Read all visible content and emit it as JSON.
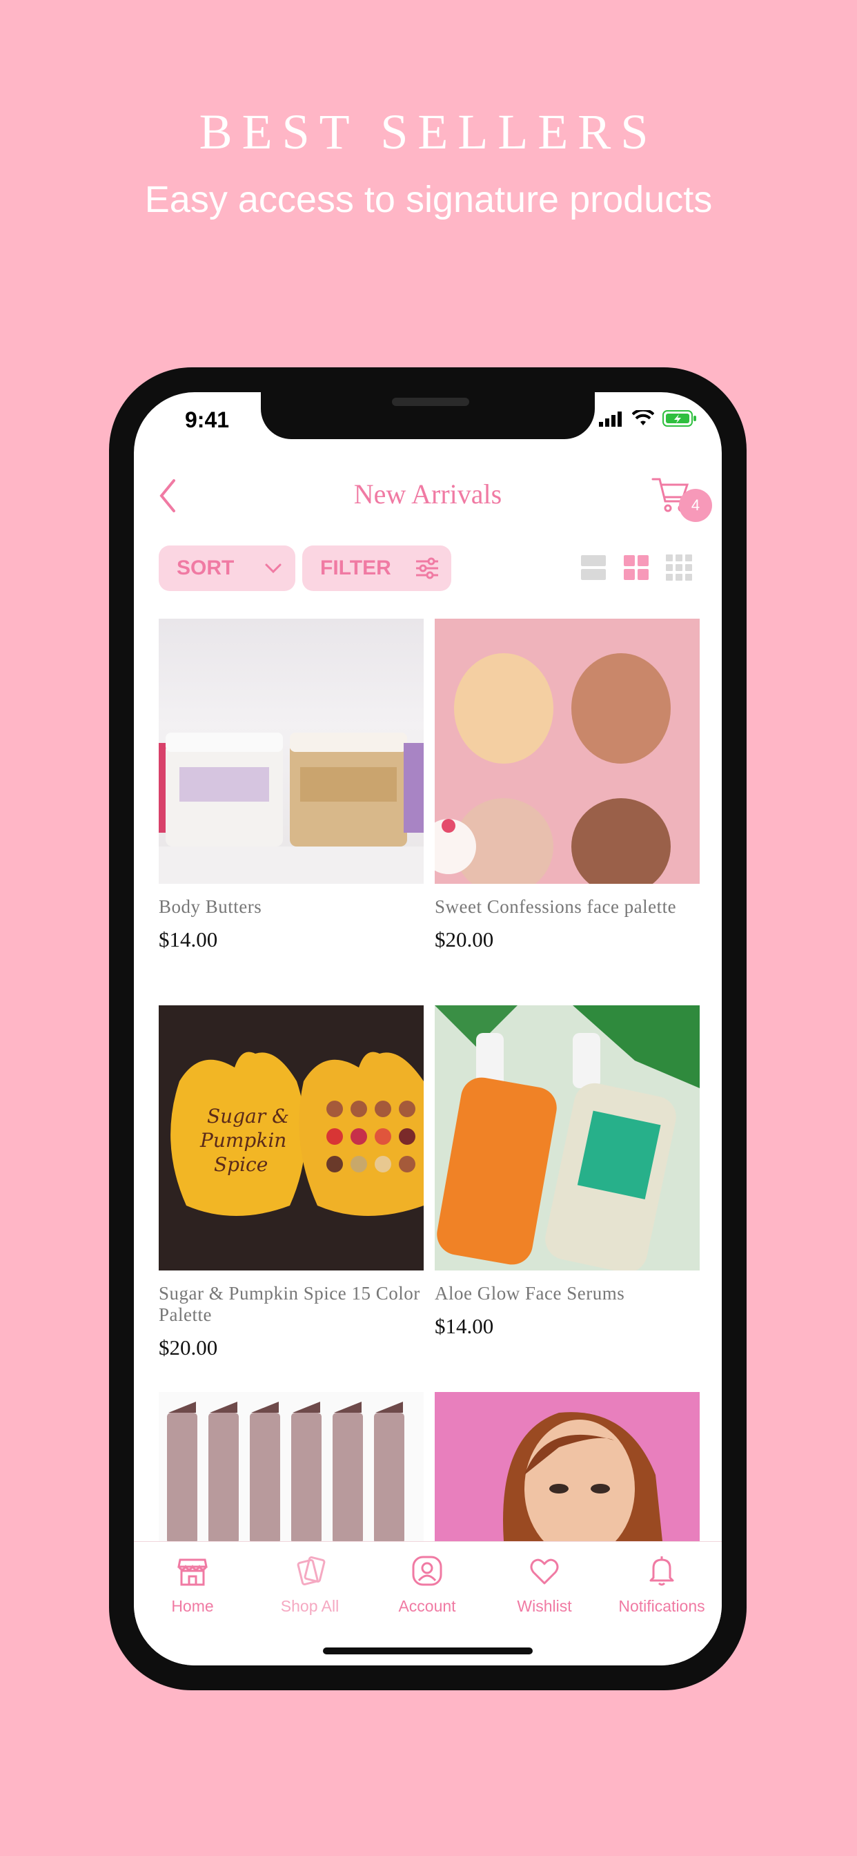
{
  "hero": {
    "title": "BEST SELLERS",
    "subtitle": "Easy access to signature products"
  },
  "status_bar": {
    "time": "9:41"
  },
  "header": {
    "title": "New Arrivals",
    "cart_count": "4"
  },
  "toolbar": {
    "sort_label": "SORT",
    "filter_label": "FILTER",
    "active_view": "grid-2"
  },
  "products": [
    {
      "name": "Body Butters",
      "price": "$14.00",
      "image": "body-butters-jars"
    },
    {
      "name": "Sweet Confessions face palette",
      "price": "$20.00",
      "image": "face-palette"
    },
    {
      "name": "Sugar & Pumpkin Spice 15 Color Palette",
      "price": "$20.00",
      "image": "pumpkin-palette"
    },
    {
      "name": "Aloe Glow Face Serums",
      "price": "$14.00",
      "image": "aloe-serums"
    },
    {
      "name": "",
      "price": "",
      "image": "lip-products"
    },
    {
      "name": "",
      "price": "",
      "image": "model-portrait"
    }
  ],
  "tabbar": {
    "items": [
      {
        "label": "Home",
        "icon": "store-icon"
      },
      {
        "label": "Shop All",
        "icon": "cards-icon"
      },
      {
        "label": "Account",
        "icon": "account-icon"
      },
      {
        "label": "Wishlist",
        "icon": "heart-icon"
      },
      {
        "label": "Notifications",
        "icon": "bell-icon"
      }
    ]
  },
  "colors": {
    "background": "#ffb6c6",
    "accent": "#f07aa3",
    "pill": "#fbd6e2"
  }
}
